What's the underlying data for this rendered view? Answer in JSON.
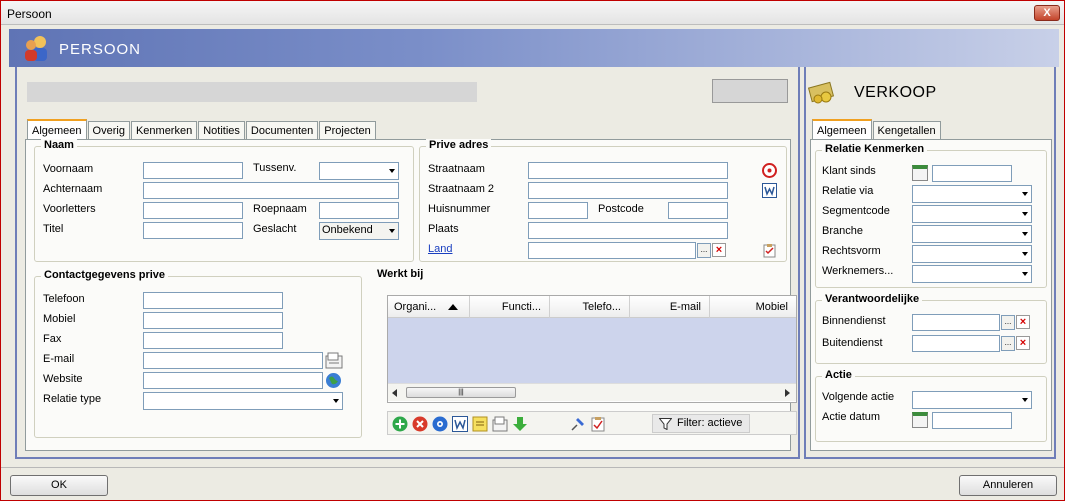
{
  "window": {
    "title": "Persoon",
    "close_label": "X"
  },
  "banner": {
    "title": "PERSOON"
  },
  "left_tabs": [
    "Algemeen",
    "Overig",
    "Kenmerken",
    "Notities",
    "Documenten",
    "Projecten"
  ],
  "naam": {
    "legend": "Naam",
    "voornaam": "Voornaam",
    "tussenv": "Tussenv.",
    "achternaam": "Achternaam",
    "voorletters": "Voorletters",
    "roepnaam": "Roepnaam",
    "titel": "Titel",
    "geslacht": "Geslacht",
    "geslacht_value": "Onbekend"
  },
  "prive_adres": {
    "legend": "Prive adres",
    "straatnaam": "Straatnaam",
    "straatnaam2": "Straatnaam 2",
    "huisnummer": "Huisnummer",
    "postcode": "Postcode",
    "plaats": "Plaats",
    "land": "Land",
    "browse": "..."
  },
  "contact": {
    "legend": "Contactgegevens prive",
    "telefoon": "Telefoon",
    "mobiel": "Mobiel",
    "fax": "Fax",
    "email": "E-mail",
    "website": "Website",
    "relatie_type": "Relatie type"
  },
  "werkt_bij": {
    "legend": "Werkt bij",
    "columns": [
      "Organi...",
      "Functi...",
      "Telefo...",
      "E-mail",
      "Mobiel"
    ],
    "scroll_grip": "|||",
    "filter_label": "Filter: actieve"
  },
  "verkoop": {
    "title": "VERKOOP",
    "tabs": [
      "Algemeen",
      "Kengetallen"
    ],
    "relatie_kenmerken": {
      "legend": "Relatie Kenmerken",
      "klant_sinds": "Klant sinds",
      "relatie_via": "Relatie via",
      "segmentcode": "Segmentcode",
      "branche": "Branche",
      "rechtsvorm": "Rechtsvorm",
      "werknemers": "Werknemers..."
    },
    "verantwoordelijke": {
      "legend": "Verantwoordelijke",
      "binnendienst": "Binnendienst",
      "buitendienst": "Buitendienst"
    },
    "actie": {
      "legend": "Actie",
      "volgende_actie": "Volgende actie",
      "actie_datum": "Actie datum"
    }
  },
  "footer": {
    "ok": "OK",
    "annuleren": "Annuleren"
  },
  "colors": {
    "banner": "#6f7eb8",
    "accent_tab": "#f0a020",
    "link": "#1a3fc0",
    "grid_body": "#cdd4ec"
  },
  "icons": [
    "person-icon",
    "target-icon",
    "word-icon",
    "clipboard-icon",
    "contact-card-icon",
    "globe-icon",
    "add-icon",
    "delete-icon",
    "settings-icon",
    "note-icon",
    "arrow-down-icon",
    "pin-icon",
    "filter-icon",
    "money-icon",
    "calendar-icon"
  ]
}
